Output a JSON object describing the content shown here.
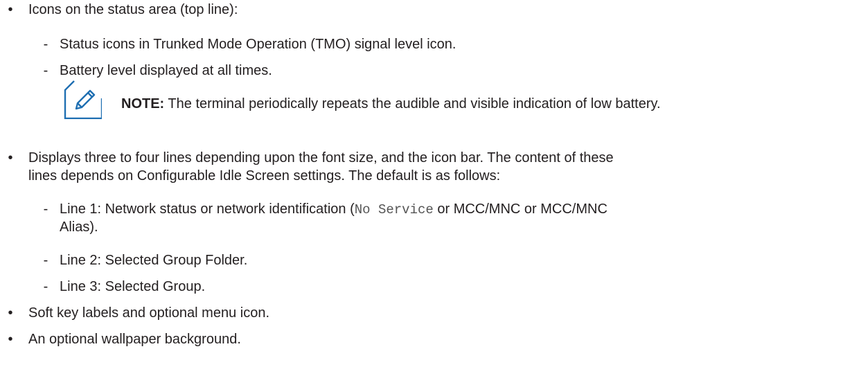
{
  "items": [
    {
      "text": "Icons on the status area (top line):",
      "subitems": [
        "Status icons in Trunked Mode Operation (TMO) signal level icon.",
        "Battery level displayed at all times."
      ],
      "note": {
        "label": "NOTE:",
        "text": "The terminal periodically repeats the audible and visible indication of low battery."
      }
    },
    {
      "text_line1": "Displays three to four lines depending upon the font size, and the icon bar. The content of these",
      "text_line2": "lines depends on Configurable Idle Screen settings. The default is as follows:",
      "subitems": [
        {
          "pre": "Line 1: Network status or network identification (",
          "code": "No Service",
          "post": " or MCC/MNC or MCC/MNC",
          "line2": "Alias)."
        },
        "Line 2: Selected Group Folder.",
        "Line 3: Selected Group."
      ]
    },
    {
      "text": "Soft key labels and optional menu icon."
    },
    {
      "text": "An optional wallpaper background."
    }
  ],
  "glyphs": {
    "bullet": "•",
    "dash": "-"
  },
  "colors": {
    "text": "#231f20",
    "note_icon": "#1f6fb2",
    "code": "#555555"
  },
  "icons": {
    "note": "note-pencil-icon"
  }
}
